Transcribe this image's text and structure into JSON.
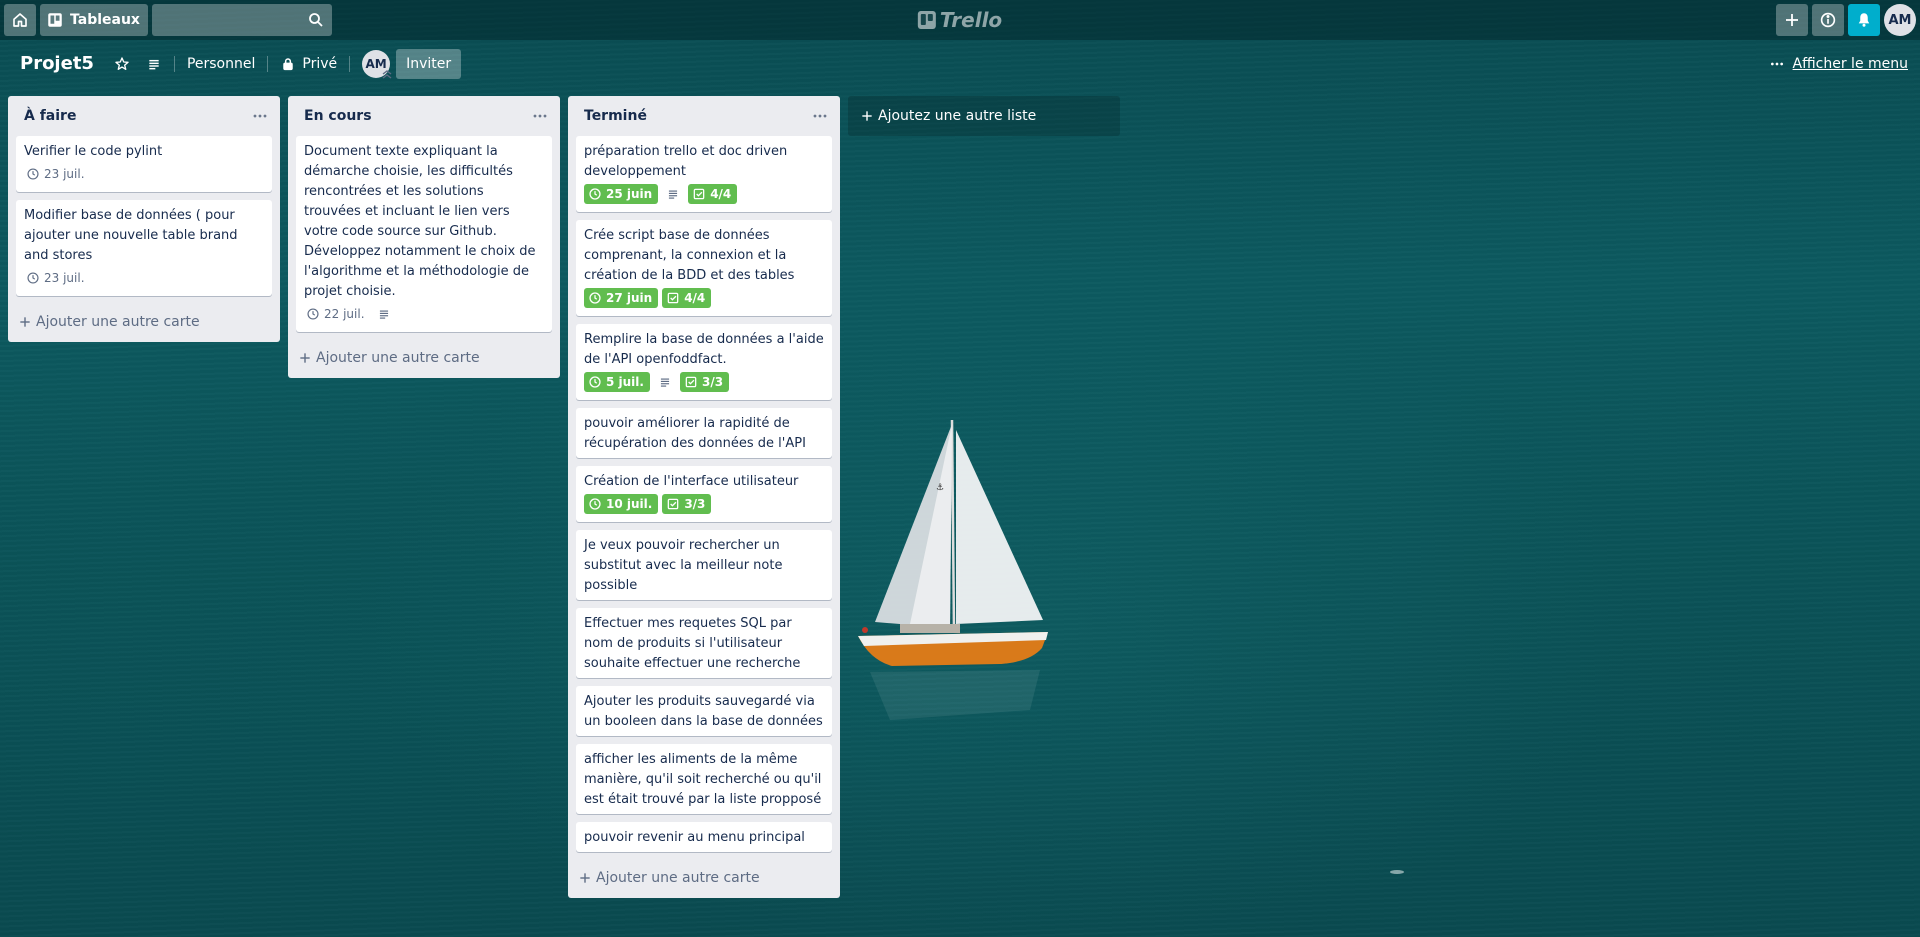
{
  "header": {
    "boards_label": "Tableaux",
    "search_value": "",
    "logo_text": "Trello",
    "user_initials": "AM"
  },
  "board": {
    "title": "Projet5",
    "team": "Personnel",
    "visibility": "Privé",
    "member_initials": "AM",
    "invite_label": "Inviter",
    "show_menu_label": "Afficher le menu"
  },
  "lists": [
    {
      "title": "À faire",
      "add_card_label": "Ajouter une autre carte",
      "cards": [
        {
          "title": "Verifier le code pylint",
          "due": "23 juil."
        },
        {
          "title": "Modifier base de données ( pour ajouter une nouvelle table brand and stores",
          "due": "23 juil."
        }
      ]
    },
    {
      "title": "En cours",
      "add_card_label": "Ajouter une autre carte",
      "cards": [
        {
          "title": "Document texte expliquant la démarche choisie, les difficultés rencontrées et les solutions trouvées et incluant le lien vers votre code source sur Github. Développez notamment le choix de l'algorithme et la méthodologie de projet choisie.",
          "due": "22 juil."
        }
      ]
    },
    {
      "title": "Terminé",
      "add_card_label": "Ajouter une autre carte",
      "cards": [
        {
          "title": "préparation trello et doc driven developpement",
          "due": "25 juin",
          "checklist": "4/4"
        },
        {
          "title": "Crée script base de données comprenant, la connexion et la création de la BDD et des tables",
          "due": "27 juin",
          "checklist": "4/4"
        },
        {
          "title": "Remplire la base de données a l'aide de l'API openfoddfact.",
          "due": "5 juil.",
          "checklist": "3/3"
        },
        {
          "title": "pouvoir améliorer la rapidité de récupération des données de l'API"
        },
        {
          "title": "Création de l'interface utilisateur",
          "due": "10 juil.",
          "checklist": "3/3"
        },
        {
          "title": "Je veux pouvoir rechercher un substitut avec la meilleur note possible"
        },
        {
          "title": "Effectuer mes requetes SQL par nom de produits si l'utilisateur souhaite effectuer une recherche"
        },
        {
          "title": "Ajouter les produits sauvegardé via un booleen dans la base de données"
        },
        {
          "title": "afficher les aliments de la même manière, qu'il soit recherché ou qu'il est était trouvé par la liste propposé"
        },
        {
          "title": "pouvoir revenir au menu principal"
        }
      ]
    }
  ],
  "add_list_label": "Ajoutez une autre liste",
  "colors": {
    "due_complete": "#61bd4f",
    "notification": "#00aecc",
    "list_bg": "#ebecf0"
  }
}
